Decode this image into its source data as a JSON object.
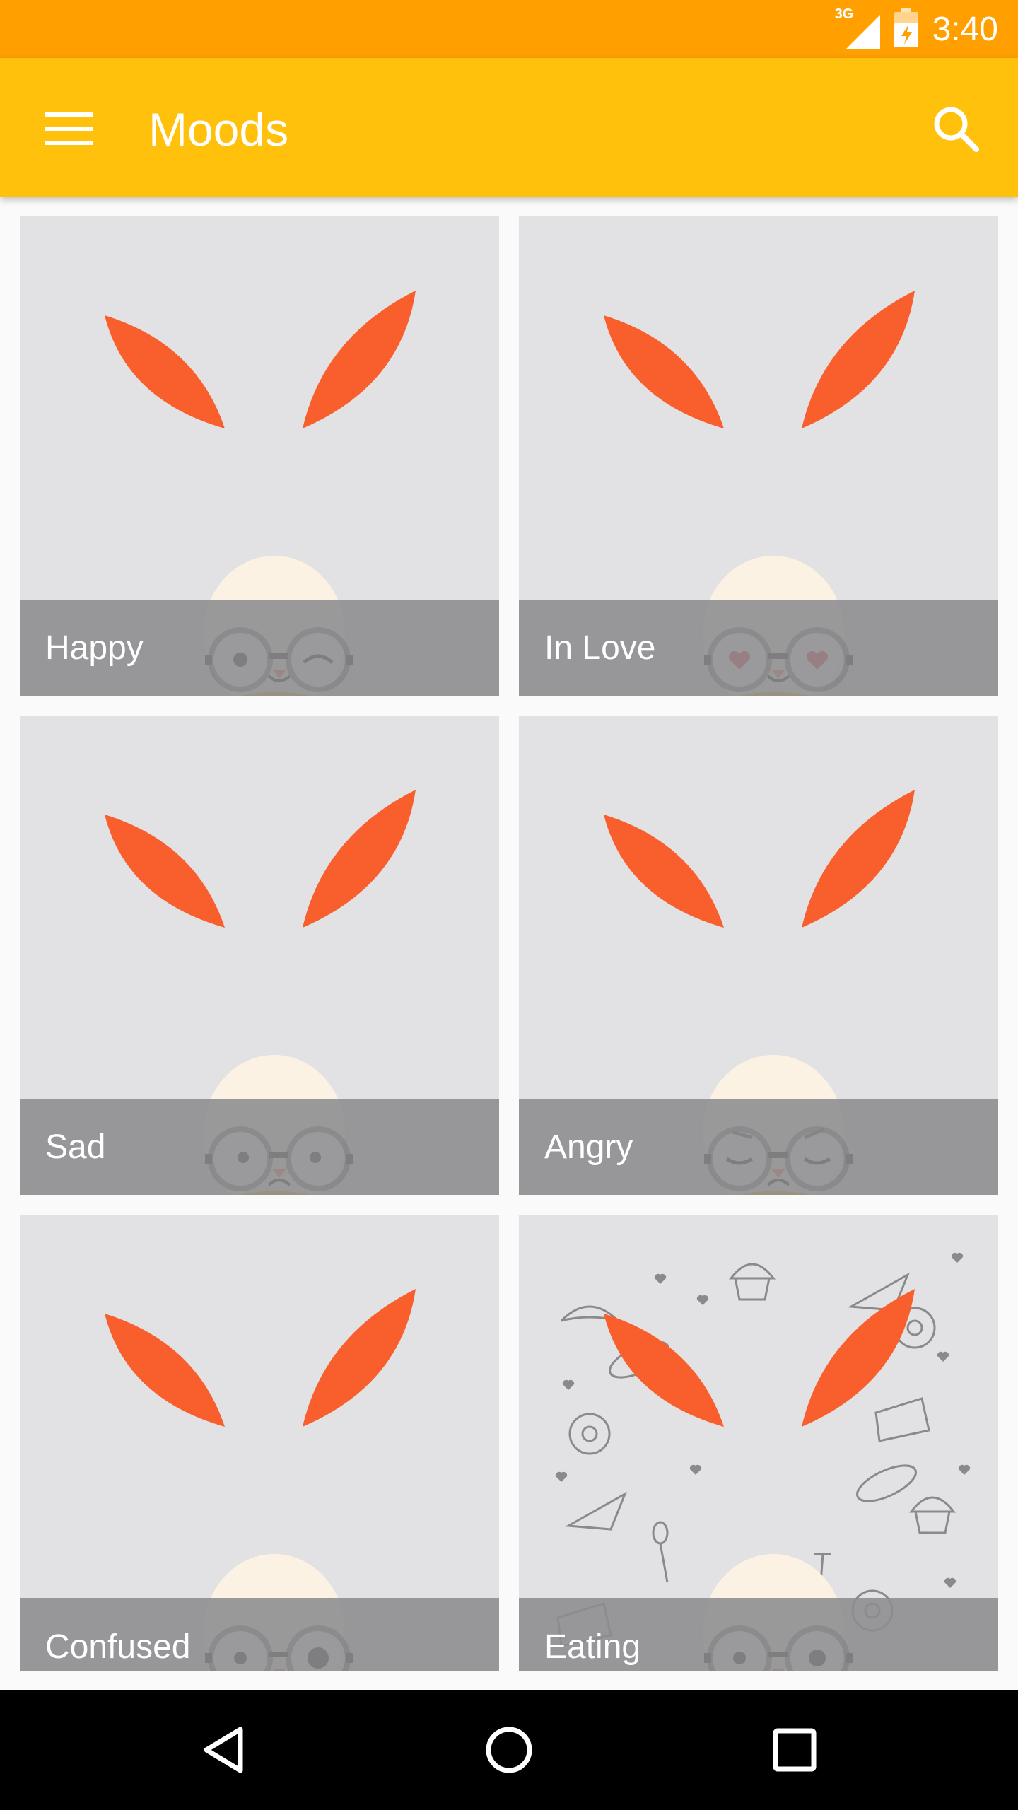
{
  "status_bar": {
    "network": "3G",
    "time": "3:40",
    "icons": [
      "signal-icon",
      "battery-icon"
    ]
  },
  "app_bar": {
    "title": "Moods",
    "icons": [
      "menu-icon",
      "search-icon"
    ]
  },
  "moods": [
    {
      "label": "Happy",
      "face": "wink"
    },
    {
      "label": "In Love",
      "face": "hearts"
    },
    {
      "label": "Sad",
      "face": "sad"
    },
    {
      "label": "Angry",
      "face": "angry"
    },
    {
      "label": "Confused",
      "face": "confused"
    },
    {
      "label": "Eating",
      "face": "eating"
    }
  ],
  "nav_bar": {
    "icons": [
      "back-icon",
      "home-icon",
      "recents-icon"
    ]
  },
  "colors": {
    "status_bar": "#ffa000",
    "app_bar": "#ffc10b",
    "ear": "#f95f2d",
    "scarf": "#f8bd16",
    "head": "#fcf2e4",
    "label_overlay": "#8c8c90"
  }
}
